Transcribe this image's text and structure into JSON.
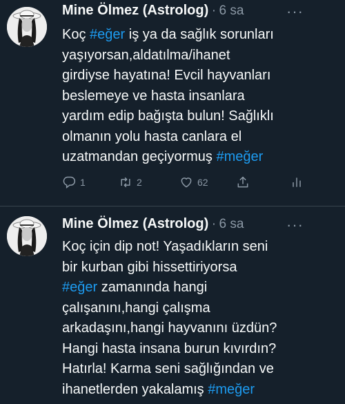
{
  "tweets": [
    {
      "author": "Mine Ölmez (Astrolog)",
      "separator": "·",
      "time": "6 sa",
      "more": "···",
      "lines": [
        [
          {
            "t": "Koç "
          },
          {
            "t": "#eğer",
            "tag": true
          },
          {
            "t": " iş ya da sağlık sorunları"
          }
        ],
        [
          {
            "t": "yaşıyorsan,aldatılma/ihanet"
          }
        ],
        [
          {
            "t": "girdiyse hayatına! Evcil hayvanları"
          }
        ],
        [
          {
            "t": "beslemeye ve hasta insanlara"
          }
        ],
        [
          {
            "t": "yardım edip bağışta bulun! Sağlıklı"
          }
        ],
        [
          {
            "t": "olmanın yolu hasta canlara el"
          }
        ],
        [
          {
            "t": "uzatmandan geçiyormuş "
          },
          {
            "t": "#meğer",
            "tag": true
          }
        ]
      ],
      "actions": {
        "reply": "1",
        "retweet": "2",
        "like": "62"
      },
      "action_icons": [
        "reply-icon",
        "retweet-icon",
        "like-icon",
        "share-icon",
        "analytics-icon"
      ]
    },
    {
      "author": "Mine Ölmez (Astrolog)",
      "separator": "·",
      "time": "6 sa",
      "more": "···",
      "lines": [
        [
          {
            "t": "Koç için dip not! Yaşadıkların seni"
          }
        ],
        [
          {
            "t": "bir kurban gibi hissettiriyorsa"
          }
        ],
        [
          {
            "t": "#eğer",
            "tag": true
          },
          {
            "t": " zamanında hangi"
          }
        ],
        [
          {
            "t": "çalışanını,hangi çalışma"
          }
        ],
        [
          {
            "t": "arkadaşını,hangi hayvanını üzdün?"
          }
        ],
        [
          {
            "t": "Hangi hasta insana burun kıvırdın?"
          }
        ],
        [
          {
            "t": "Hatırla! Karma seni sağlığından ve"
          }
        ],
        [
          {
            "t": "ihanetlerden yakalamış "
          },
          {
            "t": "#meğer",
            "tag": true
          }
        ]
      ]
    }
  ],
  "colors": {
    "background": "#15202b",
    "text": "#f7f9f9",
    "muted": "#8b98a5",
    "hashtag": "#1d9bf0",
    "divider": "#38444d"
  }
}
